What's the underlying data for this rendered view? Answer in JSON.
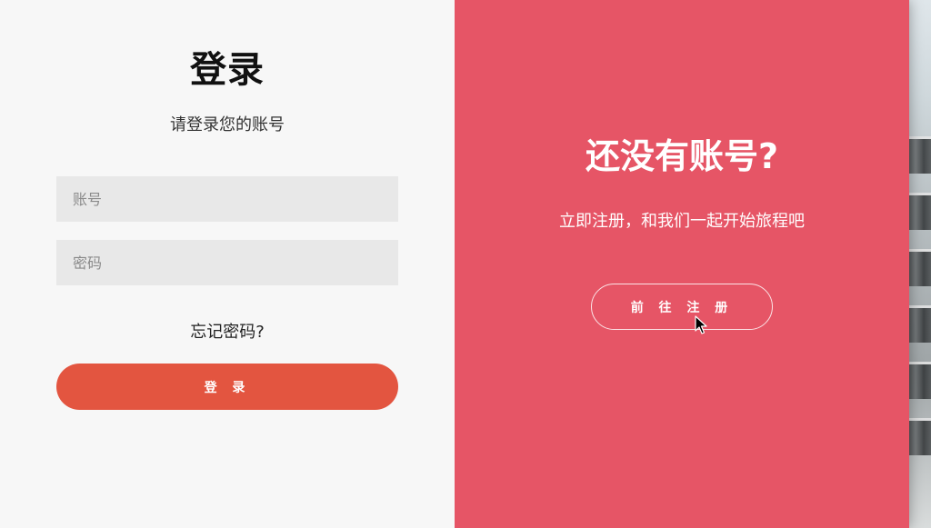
{
  "login": {
    "title": "登录",
    "subtitle": "请登录您的账号",
    "account_placeholder": "账号",
    "password_placeholder": "密码",
    "forgot_link": "忘记密码?",
    "submit_label": "登 录"
  },
  "register_promo": {
    "title": "还没有账号?",
    "text": "立即注册，和我们一起开始旅程吧",
    "button_label": "前 往 注 册"
  },
  "icons": {
    "cursor": "mouse-pointer-icon"
  },
  "colors": {
    "login_button": "#e35540",
    "promo_panel": "#e65566",
    "left_panel": "#f7f7f7",
    "input_bg": "#e8e8e8"
  }
}
